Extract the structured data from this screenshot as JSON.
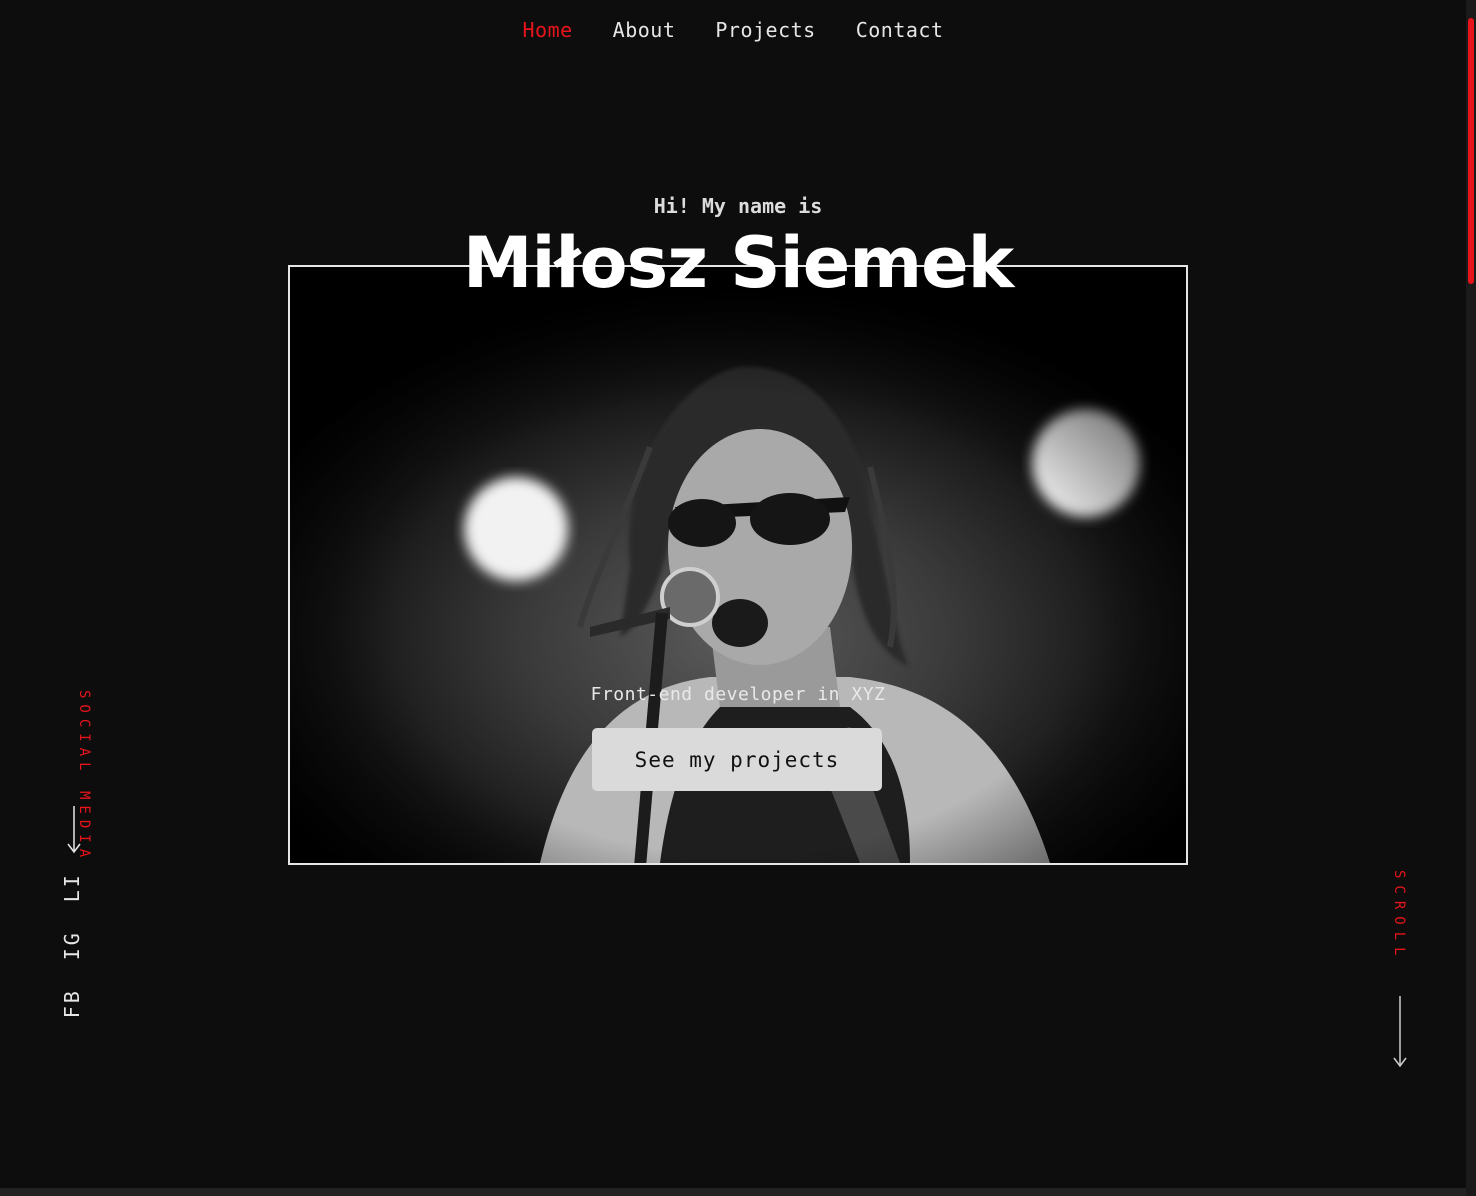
{
  "nav": {
    "items": [
      {
        "label": "Home",
        "active": true
      },
      {
        "label": "About",
        "active": false
      },
      {
        "label": "Projects",
        "active": false
      },
      {
        "label": "Contact",
        "active": false
      }
    ]
  },
  "hero": {
    "greeting": "Hi! My name is",
    "name": "Miłosz Siemek",
    "tagline": "Front-end developer in XYZ",
    "cta_label": "See my projects",
    "photo_icon": "portrait-photo"
  },
  "social": {
    "label": "SOCIAL MEDIA",
    "links": [
      "FB",
      "IG",
      "LI"
    ]
  },
  "scroll": {
    "label": "SCROLL"
  },
  "colors": {
    "accent": "#e8141b",
    "background": "#0d0d0d",
    "text": "#e6e6e6",
    "button": "#dadada"
  }
}
